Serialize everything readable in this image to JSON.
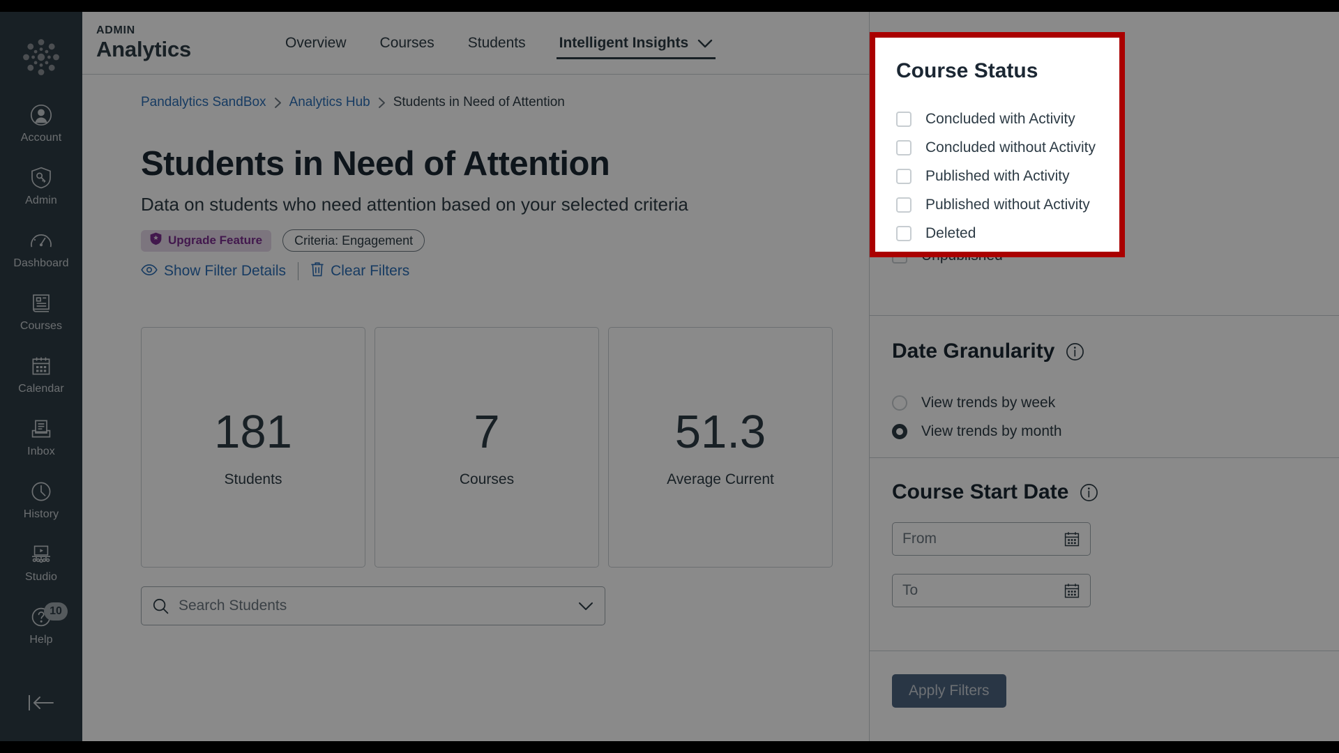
{
  "globalnav": {
    "logo_icon": "canvas-logo-icon",
    "items": [
      {
        "label": "Account",
        "icon": "user-avatar-icon"
      },
      {
        "label": "Admin",
        "icon": "shield-key-icon"
      },
      {
        "label": "Dashboard",
        "icon": "gauge-icon"
      },
      {
        "label": "Courses",
        "icon": "book-icon"
      },
      {
        "label": "Calendar",
        "icon": "calendar-icon"
      },
      {
        "label": "Inbox",
        "icon": "inbox-tray-icon"
      },
      {
        "label": "History",
        "icon": "clock-icon"
      },
      {
        "label": "Studio",
        "icon": "studio-screen-icon"
      },
      {
        "label": "Help",
        "icon": "help-question-icon",
        "badge": "10"
      }
    ],
    "collapse_icon": "collapse-arrow-icon"
  },
  "header": {
    "kicker": "ADMIN",
    "title": "Analytics",
    "tabs": [
      {
        "label": "Overview",
        "active": false
      },
      {
        "label": "Courses",
        "active": false
      },
      {
        "label": "Students",
        "active": false
      },
      {
        "label": "Intelligent Insights",
        "active": true,
        "has_chevron": true
      }
    ]
  },
  "breadcrumb": {
    "items": [
      "Pandalytics SandBox",
      "Analytics Hub",
      "Students in Need of Attention"
    ],
    "separator_icon": "chevron-right-icon"
  },
  "page": {
    "title": "Students in Need of Attention",
    "subtitle": "Data on students who need attention based on your selected criteria",
    "upgrade_badge": "Upgrade Feature",
    "upgrade_icon": "shield-star-icon",
    "criteria_badge": "Criteria: Engagement",
    "show_filter_details": "Show Filter Details",
    "show_filter_details_icon": "eye-icon",
    "clear_filters": "Clear Filters",
    "clear_filters_icon": "trash-icon"
  },
  "stats": [
    {
      "value": "181",
      "label": "Students"
    },
    {
      "value": "7",
      "label": "Courses"
    },
    {
      "value": "51.3",
      "label": "Average Current"
    }
  ],
  "search": {
    "placeholder": "Search Students",
    "search_icon": "search-icon",
    "chevron_icon": "chevron-down-icon"
  },
  "tray": {
    "course_status": {
      "title": "Course Status",
      "options": [
        {
          "label": "Concluded with Activity",
          "checked": false
        },
        {
          "label": "Concluded without Activity",
          "checked": false
        },
        {
          "label": "Published with Activity",
          "checked": false
        },
        {
          "label": "Published without Activity",
          "checked": false
        },
        {
          "label": "Deleted",
          "checked": false
        },
        {
          "label": "Unpublished",
          "checked": false
        }
      ]
    },
    "date_granularity": {
      "title": "Date Granularity",
      "info_icon": "info-circle-icon",
      "options": [
        {
          "label": "View trends by week",
          "selected": false
        },
        {
          "label": "View trends by month",
          "selected": true
        }
      ]
    },
    "course_start_date": {
      "title": "Course Start Date",
      "info_icon": "info-circle-icon",
      "from_placeholder": "From",
      "to_placeholder": "To",
      "calendar_icon": "calendar-icon"
    },
    "apply_label": "Apply Filters"
  },
  "highlight": {
    "color": "#AA0000"
  }
}
